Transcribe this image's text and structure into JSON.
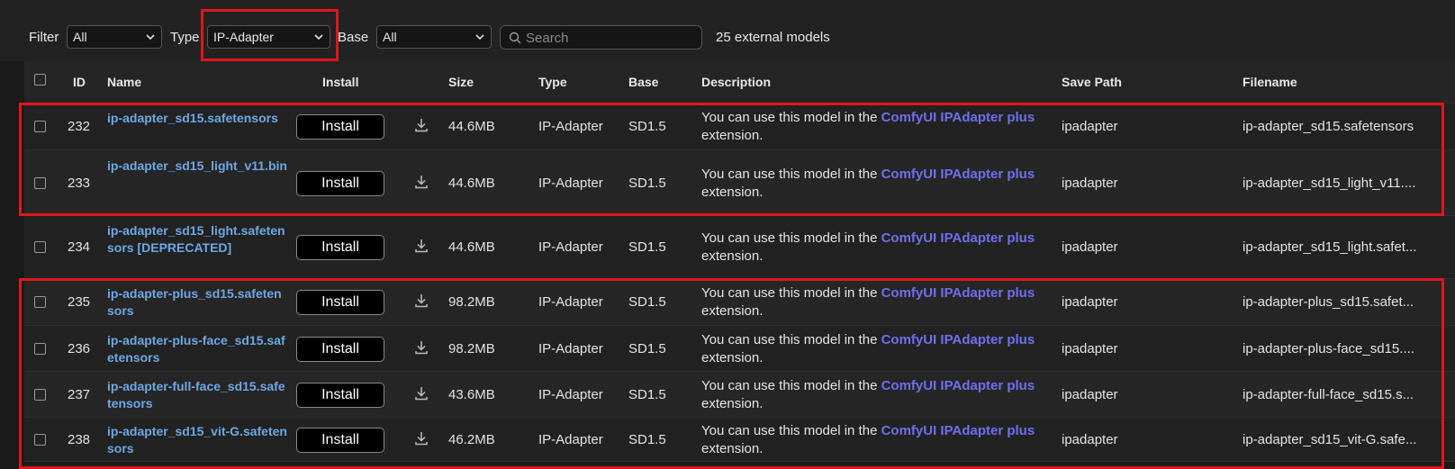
{
  "toolbar": {
    "filter_label": "Filter",
    "filter_value": "All",
    "type_label": "Type",
    "type_value": "IP-Adapter",
    "base_label": "Base",
    "base_value": "All",
    "search_placeholder": "Search",
    "count_text": "25 external models"
  },
  "columns": {
    "id": "ID",
    "name": "Name",
    "install": "Install",
    "size": "Size",
    "type": "Type",
    "base": "Base",
    "description": "Description",
    "save_path": "Save Path",
    "filename": "Filename"
  },
  "desc_text": {
    "prefix": "You can use this model in the",
    "link": "ComfyUI IPAdapter plus",
    "suffix": "extension."
  },
  "rows": [
    {
      "id": "232",
      "name": "ip-adapter_sd15.safetensors",
      "install": "Install",
      "size": "44.6MB",
      "type": "IP-Adapter",
      "base": "SD1.5",
      "save_path": "ipadapter",
      "filename": "ip-adapter_sd15.safetensors"
    },
    {
      "id": "233",
      "name": "ip-adapter_sd15_light_v11.bin",
      "install": "Install",
      "size": "44.6MB",
      "type": "IP-Adapter",
      "base": "SD1.5",
      "save_path": "ipadapter",
      "filename": "ip-adapter_sd15_light_v11...."
    },
    {
      "id": "234",
      "name": "ip-adapter_sd15_light.safetensors [DEPRECATED]",
      "install": "Install",
      "size": "44.6MB",
      "type": "IP-Adapter",
      "base": "SD1.5",
      "save_path": "ipadapter",
      "filename": "ip-adapter_sd15_light.safet..."
    },
    {
      "id": "235",
      "name": "ip-adapter-plus_sd15.safetensors",
      "install": "Install",
      "size": "98.2MB",
      "type": "IP-Adapter",
      "base": "SD1.5",
      "save_path": "ipadapter",
      "filename": "ip-adapter-plus_sd15.safet..."
    },
    {
      "id": "236",
      "name": "ip-adapter-plus-face_sd15.safetensors",
      "install": "Install",
      "size": "98.2MB",
      "type": "IP-Adapter",
      "base": "SD1.5",
      "save_path": "ipadapter",
      "filename": "ip-adapter-plus-face_sd15...."
    },
    {
      "id": "237",
      "name": "ip-adapter-full-face_sd15.safetensors",
      "install": "Install",
      "size": "43.6MB",
      "type": "IP-Adapter",
      "base": "SD1.5",
      "save_path": "ipadapter",
      "filename": "ip-adapter-full-face_sd15.s..."
    },
    {
      "id": "238",
      "name": "ip-adapter_sd15_vit-G.safetensors",
      "install": "Install",
      "size": "46.2MB",
      "type": "IP-Adapter",
      "base": "SD1.5",
      "save_path": "ipadapter",
      "filename": "ip-adapter_sd15_vit-G.safe..."
    }
  ],
  "colors": {
    "background": "#1a1a1a",
    "link": "#6f6ff0",
    "name_link": "#6ea8e4",
    "highlight": "#e0161c"
  }
}
